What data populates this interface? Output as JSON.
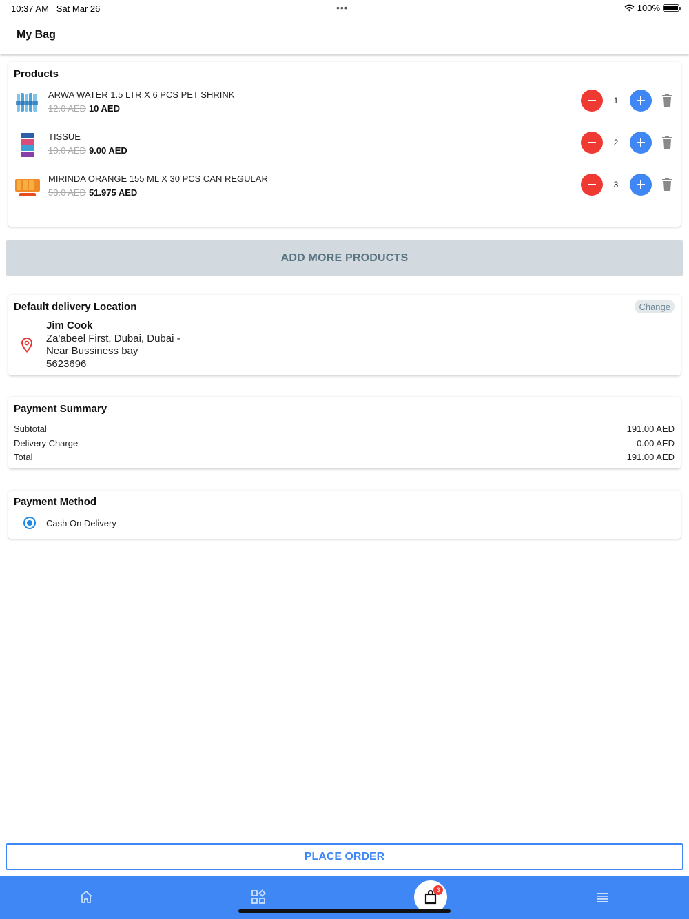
{
  "status": {
    "time": "10:37 AM",
    "date": "Sat Mar 26",
    "battery": "100%"
  },
  "header": {
    "title": "My Bag"
  },
  "products": {
    "title": "Products",
    "items": [
      {
        "name": "ARWA WATER 1.5 LTR X 6 PCS PET SHRINK",
        "old_price": "12.0 AED",
        "price": "10 AED",
        "qty": "1"
      },
      {
        "name": "TISSUE",
        "old_price": "10.0 AED",
        "price": "9.00 AED",
        "qty": "2"
      },
      {
        "name": "MIRINDA ORANGE 155 ML X 30 PCS CAN REGULAR",
        "old_price": "53.0 AED",
        "price": "51.975 AED",
        "qty": "3"
      }
    ]
  },
  "add_more_label": "ADD MORE PRODUCTS",
  "delivery": {
    "title": "Default delivery Location",
    "change_label": "Change",
    "name": "Jim  Cook",
    "line1": "Za'abeel First, Dubai, Dubai -",
    "line2": "Near Bussiness bay",
    "phone": "5623696"
  },
  "summary": {
    "title": "Payment Summary",
    "rows": [
      {
        "label": "Subtotal",
        "value": "191.00 AED"
      },
      {
        "label": "Delivery Charge",
        "value": "0.00 AED"
      },
      {
        "label": "Total",
        "value": "191.00 AED"
      }
    ]
  },
  "payment_method": {
    "title": "Payment Method",
    "option": "Cash On Delivery",
    "selected": true
  },
  "place_order_label": "PLACE ORDER",
  "nav": {
    "bag_count": "3",
    "icons": [
      "home-icon",
      "categories-icon",
      "bag-icon",
      "menu-icon"
    ]
  },
  "colors": {
    "accent": "#3f87f4",
    "minus": "#ef3a33",
    "add_more_bg": "#d2dadf",
    "add_more_text": "#5a7383"
  }
}
